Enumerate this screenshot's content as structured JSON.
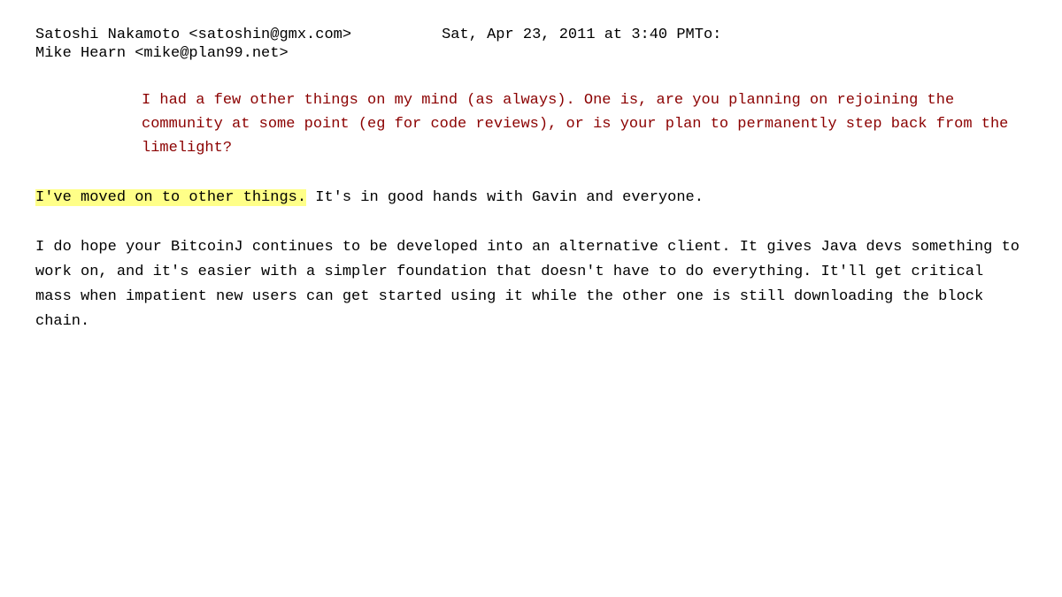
{
  "email": {
    "header": {
      "sender": "Satoshi Nakamoto <satoshin@gmx.com>",
      "datetime": "Sat, Apr 23, 2011 at 3:40 PMTo:",
      "recipient": "Mike Hearn <mike@plan99.net>"
    },
    "quoted_text": "I had a few other things on my mind (as always). One is, are you planning on rejoining the community at some point (eg for code reviews), or is your plan to permanently step back from the limelight?",
    "highlighted_phrase": "I've moved on to other things.",
    "reply_continuation": " It's in good hands with Gavin and everyone.",
    "main_paragraph": "I do hope your BitcoinJ continues to be developed into an alternative client.  It gives Java devs something to work on, and it's easier with a simpler foundation that doesn't have to do everything.  It'll get critical mass when impatient new users can get started using it while the other one is still downloading the block chain."
  }
}
